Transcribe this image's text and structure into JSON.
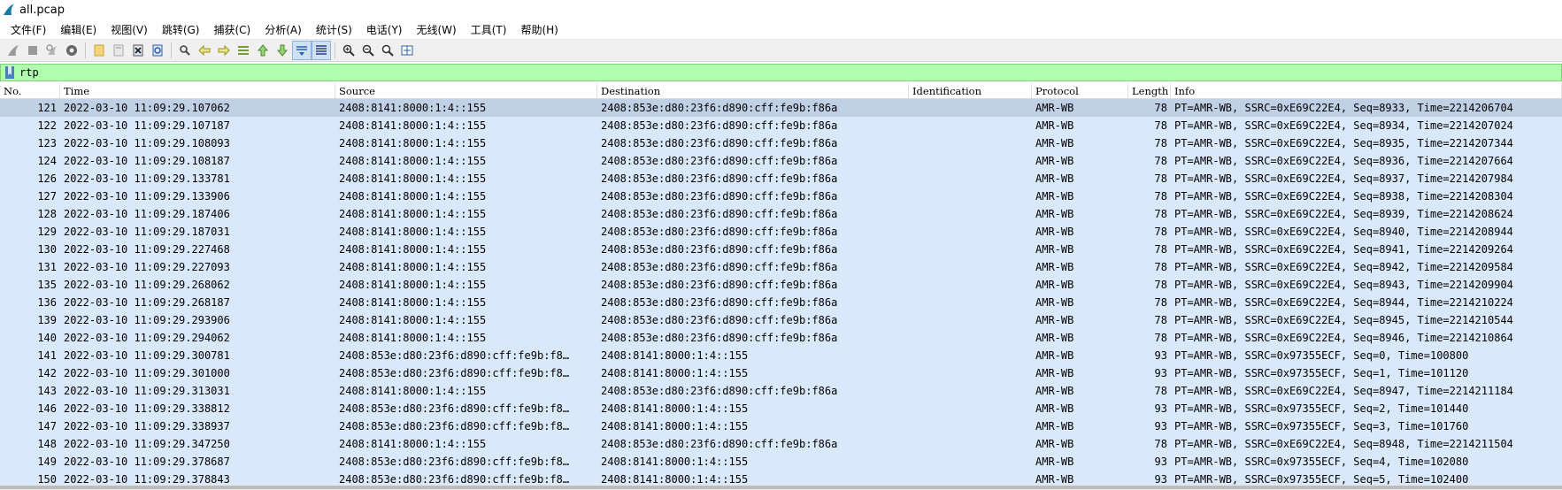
{
  "window": {
    "title": "all.pcap"
  },
  "menu": [
    "文件(F)",
    "编辑(E)",
    "视图(V)",
    "跳转(G)",
    "捕获(C)",
    "分析(A)",
    "统计(S)",
    "电话(Y)",
    "无线(W)",
    "工具(T)",
    "帮助(H)"
  ],
  "toolbar": {
    "icons": [
      "shark-fin-start-icon",
      "stop-icon",
      "restart-icon",
      "capture-options-icon",
      "open-file-icon",
      "save-file-icon",
      "close-file-icon",
      "reload-icon",
      "find-packet-icon",
      "go-back-icon",
      "go-forward-icon",
      "go-to-packet-icon",
      "go-first-icon",
      "go-last-icon",
      "auto-scroll-icon",
      "colorize-icon",
      "zoom-in-icon",
      "zoom-out-icon",
      "normal-size-icon",
      "resize-columns-icon"
    ]
  },
  "filter": {
    "value": "rtp"
  },
  "columns": [
    "No.",
    "Time",
    "Source",
    "Destination",
    "Identification",
    "Protocol",
    "Length",
    "Info"
  ],
  "packets": [
    {
      "no": "121",
      "time": "2022-03-10 11:09:29.107062",
      "src": "2408:8141:8000:1:4::155",
      "dst": "2408:853e:d80:23f6:d890:cff:fe9b:f86a",
      "id": "",
      "proto": "AMR-WB",
      "len": "78",
      "info": "PT=AMR-WB, SSRC=0xE69C22E4, Seq=8933, Time=2214206704"
    },
    {
      "no": "122",
      "time": "2022-03-10 11:09:29.107187",
      "src": "2408:8141:8000:1:4::155",
      "dst": "2408:853e:d80:23f6:d890:cff:fe9b:f86a",
      "id": "",
      "proto": "AMR-WB",
      "len": "78",
      "info": "PT=AMR-WB, SSRC=0xE69C22E4, Seq=8934, Time=2214207024"
    },
    {
      "no": "123",
      "time": "2022-03-10 11:09:29.108093",
      "src": "2408:8141:8000:1:4::155",
      "dst": "2408:853e:d80:23f6:d890:cff:fe9b:f86a",
      "id": "",
      "proto": "AMR-WB",
      "len": "78",
      "info": "PT=AMR-WB, SSRC=0xE69C22E4, Seq=8935, Time=2214207344"
    },
    {
      "no": "124",
      "time": "2022-03-10 11:09:29.108187",
      "src": "2408:8141:8000:1:4::155",
      "dst": "2408:853e:d80:23f6:d890:cff:fe9b:f86a",
      "id": "",
      "proto": "AMR-WB",
      "len": "78",
      "info": "PT=AMR-WB, SSRC=0xE69C22E4, Seq=8936, Time=2214207664"
    },
    {
      "no": "126",
      "time": "2022-03-10 11:09:29.133781",
      "src": "2408:8141:8000:1:4::155",
      "dst": "2408:853e:d80:23f6:d890:cff:fe9b:f86a",
      "id": "",
      "proto": "AMR-WB",
      "len": "78",
      "info": "PT=AMR-WB, SSRC=0xE69C22E4, Seq=8937, Time=2214207984"
    },
    {
      "no": "127",
      "time": "2022-03-10 11:09:29.133906",
      "src": "2408:8141:8000:1:4::155",
      "dst": "2408:853e:d80:23f6:d890:cff:fe9b:f86a",
      "id": "",
      "proto": "AMR-WB",
      "len": "78",
      "info": "PT=AMR-WB, SSRC=0xE69C22E4, Seq=8938, Time=2214208304"
    },
    {
      "no": "128",
      "time": "2022-03-10 11:09:29.187406",
      "src": "2408:8141:8000:1:4::155",
      "dst": "2408:853e:d80:23f6:d890:cff:fe9b:f86a",
      "id": "",
      "proto": "AMR-WB",
      "len": "78",
      "info": "PT=AMR-WB, SSRC=0xE69C22E4, Seq=8939, Time=2214208624"
    },
    {
      "no": "129",
      "time": "2022-03-10 11:09:29.187031",
      "src": "2408:8141:8000:1:4::155",
      "dst": "2408:853e:d80:23f6:d890:cff:fe9b:f86a",
      "id": "",
      "proto": "AMR-WB",
      "len": "78",
      "info": "PT=AMR-WB, SSRC=0xE69C22E4, Seq=8940, Time=2214208944"
    },
    {
      "no": "130",
      "time": "2022-03-10 11:09:29.227468",
      "src": "2408:8141:8000:1:4::155",
      "dst": "2408:853e:d80:23f6:d890:cff:fe9b:f86a",
      "id": "",
      "proto": "AMR-WB",
      "len": "78",
      "info": "PT=AMR-WB, SSRC=0xE69C22E4, Seq=8941, Time=2214209264"
    },
    {
      "no": "131",
      "time": "2022-03-10 11:09:29.227093",
      "src": "2408:8141:8000:1:4::155",
      "dst": "2408:853e:d80:23f6:d890:cff:fe9b:f86a",
      "id": "",
      "proto": "AMR-WB",
      "len": "78",
      "info": "PT=AMR-WB, SSRC=0xE69C22E4, Seq=8942, Time=2214209584"
    },
    {
      "no": "135",
      "time": "2022-03-10 11:09:29.268062",
      "src": "2408:8141:8000:1:4::155",
      "dst": "2408:853e:d80:23f6:d890:cff:fe9b:f86a",
      "id": "",
      "proto": "AMR-WB",
      "len": "78",
      "info": "PT=AMR-WB, SSRC=0xE69C22E4, Seq=8943, Time=2214209904"
    },
    {
      "no": "136",
      "time": "2022-03-10 11:09:29.268187",
      "src": "2408:8141:8000:1:4::155",
      "dst": "2408:853e:d80:23f6:d890:cff:fe9b:f86a",
      "id": "",
      "proto": "AMR-WB",
      "len": "78",
      "info": "PT=AMR-WB, SSRC=0xE69C22E4, Seq=8944, Time=2214210224"
    },
    {
      "no": "139",
      "time": "2022-03-10 11:09:29.293906",
      "src": "2408:8141:8000:1:4::155",
      "dst": "2408:853e:d80:23f6:d890:cff:fe9b:f86a",
      "id": "",
      "proto": "AMR-WB",
      "len": "78",
      "info": "PT=AMR-WB, SSRC=0xE69C22E4, Seq=8945, Time=2214210544"
    },
    {
      "no": "140",
      "time": "2022-03-10 11:09:29.294062",
      "src": "2408:8141:8000:1:4::155",
      "dst": "2408:853e:d80:23f6:d890:cff:fe9b:f86a",
      "id": "",
      "proto": "AMR-WB",
      "len": "78",
      "info": "PT=AMR-WB, SSRC=0xE69C22E4, Seq=8946, Time=2214210864"
    },
    {
      "no": "141",
      "time": "2022-03-10 11:09:29.300781",
      "src": "2408:853e:d80:23f6:d890:cff:fe9b:f8…",
      "dst": "2408:8141:8000:1:4::155",
      "id": "",
      "proto": "AMR-WB",
      "len": "93",
      "info": "PT=AMR-WB, SSRC=0x97355ECF, Seq=0, Time=100800"
    },
    {
      "no": "142",
      "time": "2022-03-10 11:09:29.301000",
      "src": "2408:853e:d80:23f6:d890:cff:fe9b:f8…",
      "dst": "2408:8141:8000:1:4::155",
      "id": "",
      "proto": "AMR-WB",
      "len": "93",
      "info": "PT=AMR-WB, SSRC=0x97355ECF, Seq=1, Time=101120"
    },
    {
      "no": "143",
      "time": "2022-03-10 11:09:29.313031",
      "src": "2408:8141:8000:1:4::155",
      "dst": "2408:853e:d80:23f6:d890:cff:fe9b:f86a",
      "id": "",
      "proto": "AMR-WB",
      "len": "78",
      "info": "PT=AMR-WB, SSRC=0xE69C22E4, Seq=8947, Time=2214211184"
    },
    {
      "no": "146",
      "time": "2022-03-10 11:09:29.338812",
      "src": "2408:853e:d80:23f6:d890:cff:fe9b:f8…",
      "dst": "2408:8141:8000:1:4::155",
      "id": "",
      "proto": "AMR-WB",
      "len": "93",
      "info": "PT=AMR-WB, SSRC=0x97355ECF, Seq=2, Time=101440"
    },
    {
      "no": "147",
      "time": "2022-03-10 11:09:29.338937",
      "src": "2408:853e:d80:23f6:d890:cff:fe9b:f8…",
      "dst": "2408:8141:8000:1:4::155",
      "id": "",
      "proto": "AMR-WB",
      "len": "93",
      "info": "PT=AMR-WB, SSRC=0x97355ECF, Seq=3, Time=101760"
    },
    {
      "no": "148",
      "time": "2022-03-10 11:09:29.347250",
      "src": "2408:8141:8000:1:4::155",
      "dst": "2408:853e:d80:23f6:d890:cff:fe9b:f86a",
      "id": "",
      "proto": "AMR-WB",
      "len": "78",
      "info": "PT=AMR-WB, SSRC=0xE69C22E4, Seq=8948, Time=2214211504"
    },
    {
      "no": "149",
      "time": "2022-03-10 11:09:29.378687",
      "src": "2408:853e:d80:23f6:d890:cff:fe9b:f8…",
      "dst": "2408:8141:8000:1:4::155",
      "id": "",
      "proto": "AMR-WB",
      "len": "93",
      "info": "PT=AMR-WB, SSRC=0x97355ECF, Seq=4, Time=102080"
    },
    {
      "no": "150",
      "time": "2022-03-10 11:09:29.378843",
      "src": "2408:853e:d80:23f6:d890:cff:fe9b:f8…",
      "dst": "2408:8141:8000:1:4::155",
      "id": "",
      "proto": "AMR-WB",
      "len": "93",
      "info": "PT=AMR-WB, SSRC=0x97355ECF, Seq=5, Time=102400"
    }
  ],
  "selected_row": 0,
  "colors": {
    "row_bg": "#dae8fb",
    "selected_bg": "#c0d1e6",
    "filter_bg": "#afffaf"
  }
}
